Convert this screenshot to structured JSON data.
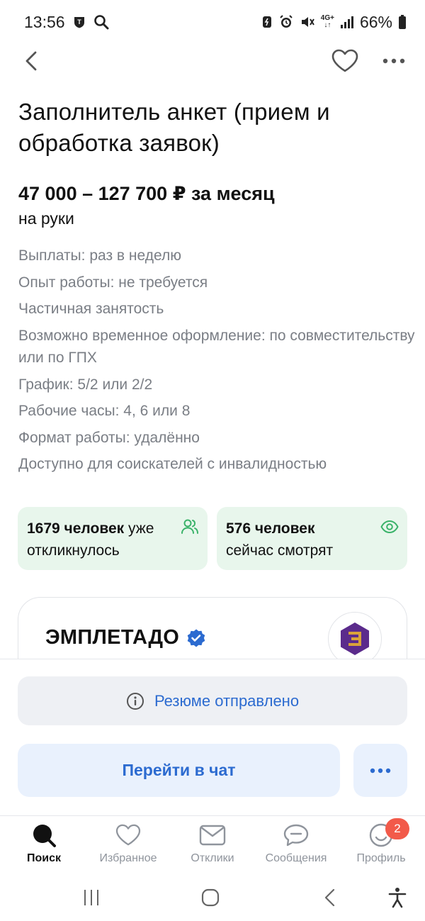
{
  "status_bar": {
    "time": "13:56",
    "network": "4G+",
    "battery": "66%"
  },
  "nav": {
    "back_icon": "chevron-left-icon",
    "favorite_icon": "heart-icon",
    "more_icon": "more-horizontal-icon"
  },
  "vacancy": {
    "title": "Заполнитель анкет (прием и обработка заявок)",
    "salary": "47 000 – 127 700 ₽ за месяц",
    "salary_note": "на руки",
    "details": [
      "Выплаты: раз в неделю",
      "Опыт работы: не требуется",
      "Частичная занятость",
      "Возможно временное оформление: по совместительству или по ГПХ",
      "График: 5/2 или 2/2",
      "Рабочие часы: 4, 6 или 8",
      "Формат работы: удалённо",
      "Доступно для соискателей с инвалидностью"
    ]
  },
  "stats": {
    "responded": {
      "count": "1679 человек",
      "suffix": " уже",
      "line2": "откликнулось"
    },
    "viewing": {
      "count": "576 человек",
      "line2": "сейчас смотрят"
    }
  },
  "employer": {
    "name": "ЭМПЛЕТАДО",
    "verified_icon": "verified-badge-icon",
    "logo_icon": "company-logo-icon"
  },
  "actions": {
    "sent_label": "Резюме отправлено",
    "chat_label": "Перейти в чат"
  },
  "tabs": [
    {
      "label": "Поиск"
    },
    {
      "label": "Избранное"
    },
    {
      "label": "Отклики"
    },
    {
      "label": "Сообщения"
    },
    {
      "label": "Профиль",
      "badge": "2"
    }
  ],
  "colors": {
    "accent": "#2c6bd0",
    "green_card": "#e8f6ec",
    "badge": "#f25a4a"
  }
}
